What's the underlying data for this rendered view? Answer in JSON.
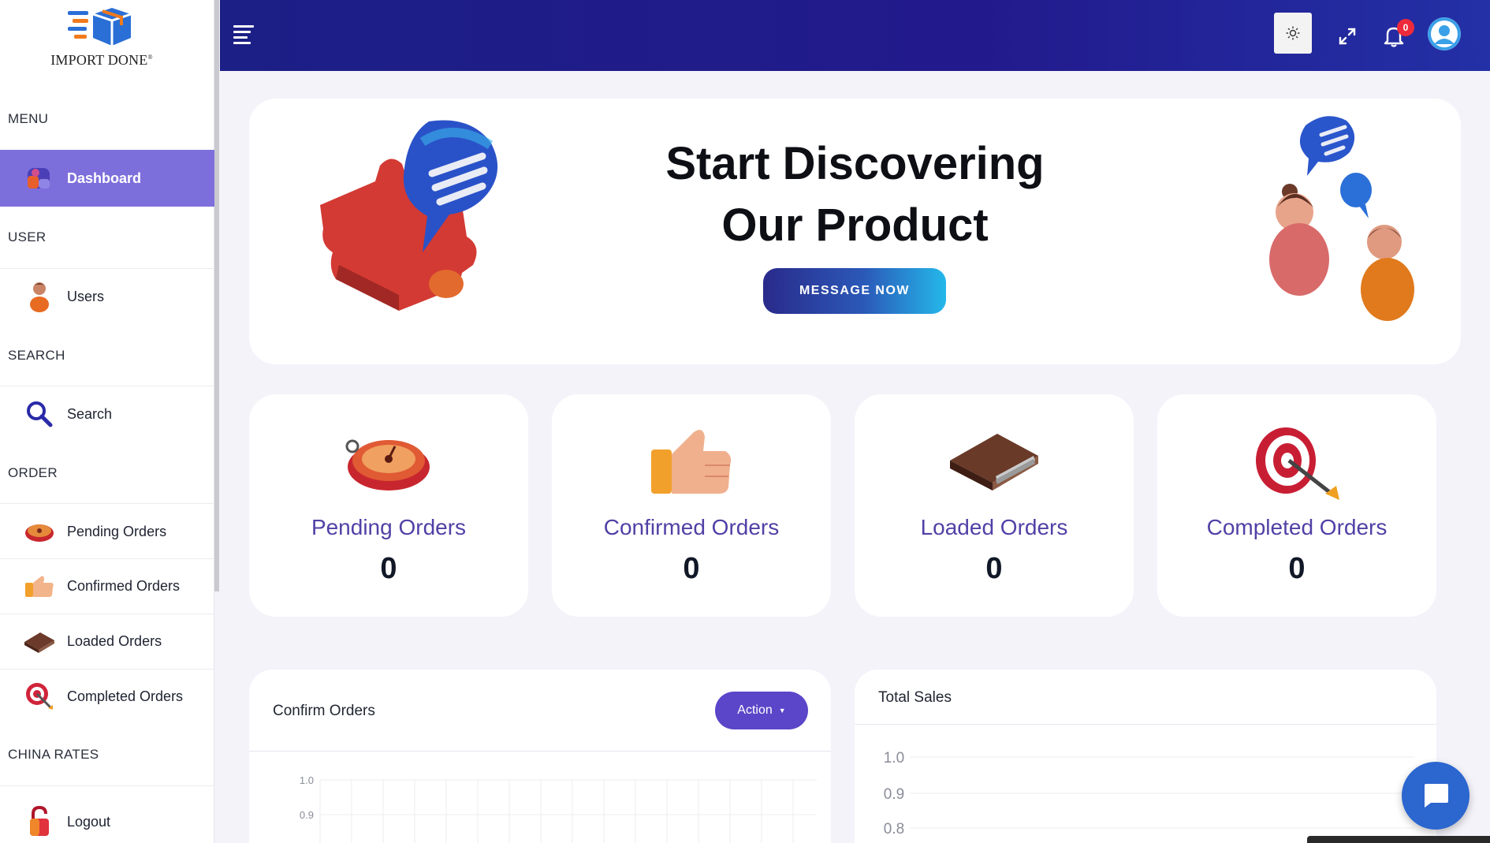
{
  "brand": {
    "name": "IMPORT DONE",
    "mark": "®"
  },
  "sidebar": {
    "sections": {
      "menu": "MENU",
      "user": "USER",
      "search": "SEARCH",
      "order": "ORDER",
      "china_rates": "CHINA RATES"
    },
    "items": [
      {
        "label": "Dashboard",
        "icon": "dashboard-icon",
        "active": true
      },
      {
        "label": "Users",
        "icon": "user-icon"
      },
      {
        "label": "Search",
        "icon": "search-icon"
      },
      {
        "label": "Pending Orders",
        "icon": "stopwatch-icon"
      },
      {
        "label": "Confirmed Orders",
        "icon": "thumbs-up-icon"
      },
      {
        "label": "Loaded Orders",
        "icon": "wallet-icon"
      },
      {
        "label": "Completed Orders",
        "icon": "target-icon"
      },
      {
        "label": "Logout",
        "icon": "lock-icon"
      }
    ]
  },
  "topbar": {
    "notification_count": "0",
    "icons": [
      "menu-icon",
      "sun-icon",
      "expand-icon",
      "bell-icon",
      "avatar"
    ]
  },
  "hero": {
    "title_line1": "Start Discovering",
    "title_line2": "Our Product",
    "button": "MESSAGE NOW"
  },
  "stats": [
    {
      "label": "Pending Orders",
      "value": "0"
    },
    {
      "label": "Confirmed Orders",
      "value": "0"
    },
    {
      "label": "Loaded Orders",
      "value": "0"
    },
    {
      "label": "Completed Orders",
      "value": "0"
    }
  ],
  "panels": {
    "confirm_orders": {
      "title": "Confirm Orders",
      "action": "Action",
      "y_ticks": [
        "1.0",
        "0.9"
      ]
    },
    "total_sales": {
      "title": "Total Sales",
      "y_ticks": [
        "1.0",
        "0.9",
        "0.8"
      ]
    }
  },
  "colors": {
    "accent": "#7c6fdb",
    "topbar": "#1c1f86",
    "label": "#5041a6",
    "badge": "#ee2a3a"
  }
}
